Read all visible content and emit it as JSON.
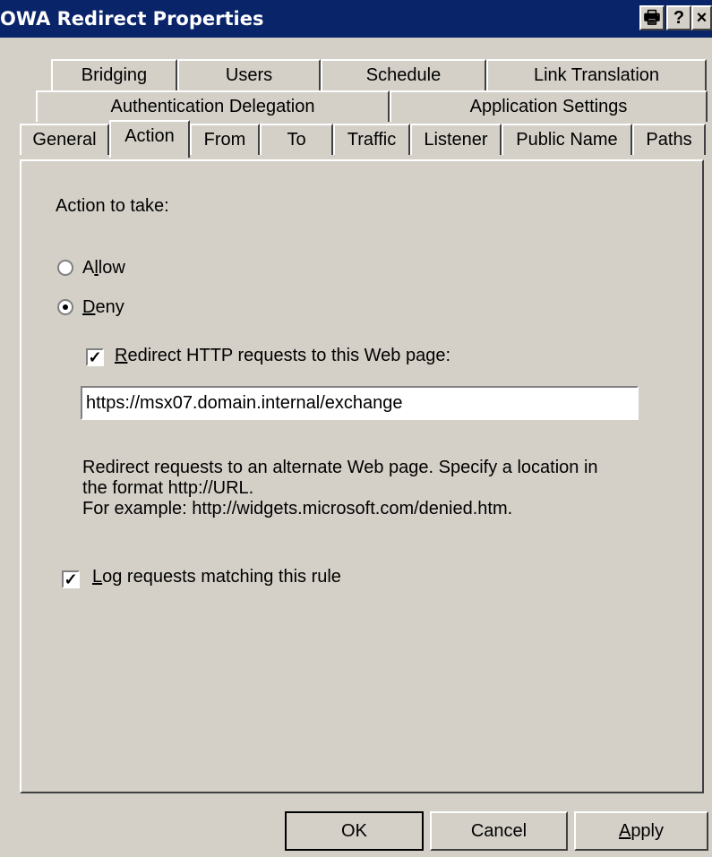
{
  "window": {
    "title": "OWA Redirect Properties",
    "controls": {
      "print": "🖶",
      "help": "?",
      "close": "×"
    }
  },
  "tabs": {
    "row1": [
      "Bridging",
      "Users",
      "Schedule",
      "Link Translation"
    ],
    "row2": [
      "Authentication Delegation",
      "Application Settings"
    ],
    "row3": [
      "General",
      "Action",
      "From",
      "To",
      "Traffic",
      "Listener",
      "Public Name",
      "Paths"
    ],
    "selected": "Action"
  },
  "action": {
    "label": "Action to take:",
    "allow": {
      "first": "A",
      "underline": "l",
      "rest": "low",
      "checked": false
    },
    "deny": {
      "first": "",
      "underline": "D",
      "rest": "eny",
      "checked": true
    },
    "redirect": {
      "first": "",
      "underline": "R",
      "rest": "edirect HTTP requests to this Web page:",
      "checked": true
    },
    "redirect_url": "https://msx07.domain.internal/exchange",
    "help_line1": "Redirect requests to an alternate Web page. Specify a location in",
    "help_line2": "the format http://URL.",
    "help_line3": "For example: http://widgets.microsoft.com/denied.htm.",
    "log": {
      "first": "",
      "underline": "L",
      "rest": "og requests matching this rule",
      "checked": true
    }
  },
  "buttons": {
    "ok": "OK",
    "cancel": "Cancel",
    "apply_underline": "A",
    "apply_rest": "pply"
  }
}
